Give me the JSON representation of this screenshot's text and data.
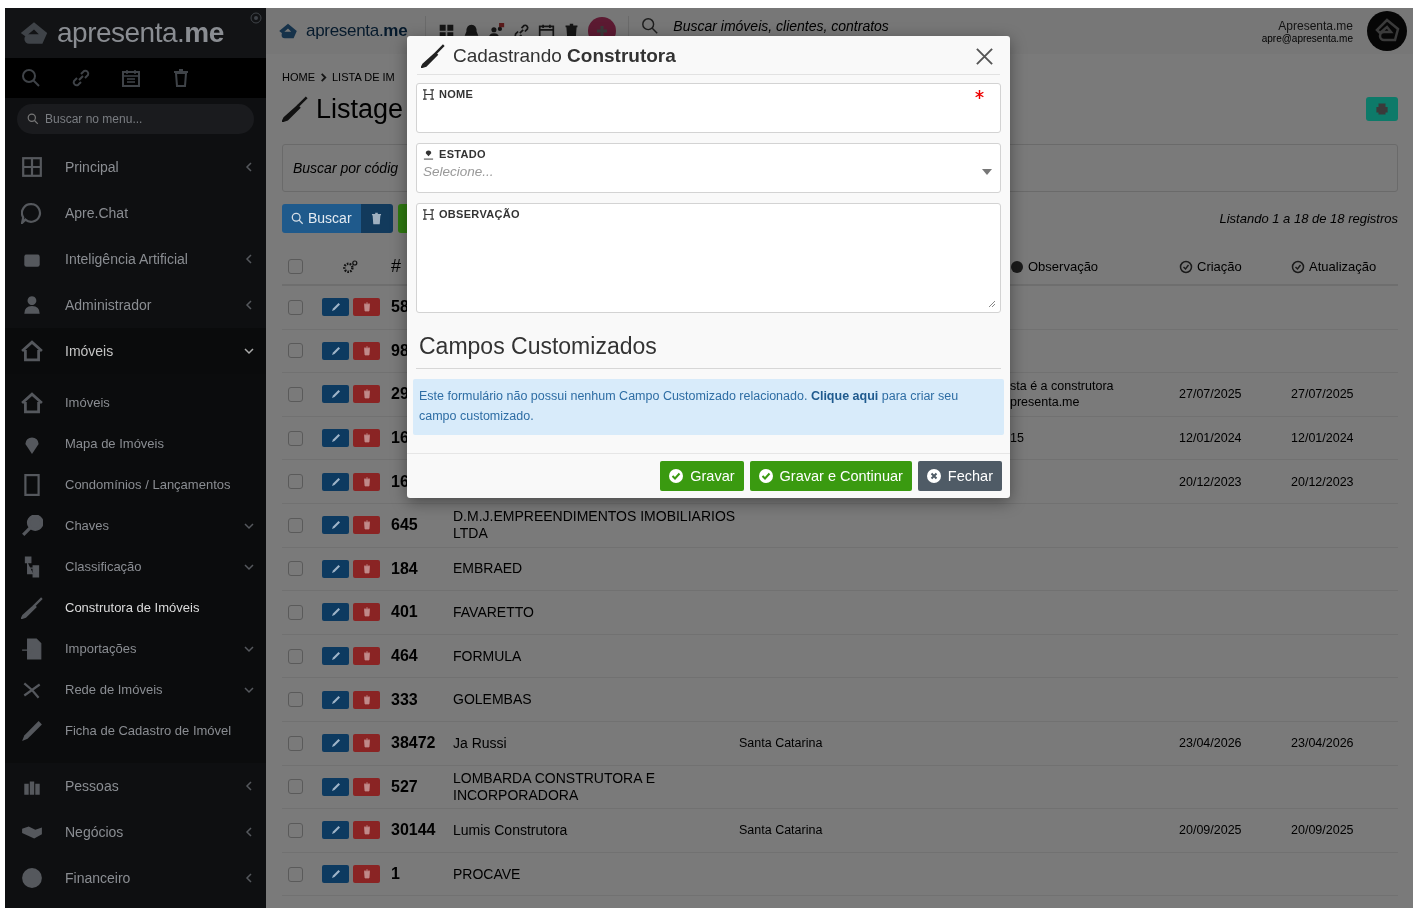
{
  "sidebar": {
    "logo": "apresenta.**me**",
    "search": {
      "placeholder": "Buscar no menu..."
    },
    "items": [
      {
        "label": "Principal",
        "submenu": true,
        "chevron_down": false,
        "selected": false
      },
      {
        "label": "Apre.Chat",
        "submenu": false,
        "selected": false
      },
      {
        "label": "Inteligência Artificial",
        "submenu": true,
        "chevron_down": false,
        "selected": false
      },
      {
        "label": "Administrador",
        "submenu": true,
        "chevron_down": false,
        "selected": false
      },
      {
        "label": "Imóveis",
        "submenu": true,
        "chevron_down": true,
        "expanded": true,
        "selected": false,
        "children": [
          {
            "label": "Imóveis",
            "submenu": false,
            "selected": false
          },
          {
            "label": "Mapa de Imóveis",
            "submenu": false,
            "selected": false
          },
          {
            "label": "Condomínios / Lançamentos",
            "submenu": false,
            "selected": false
          },
          {
            "label": "Chaves",
            "submenu": true,
            "chevron_down": true,
            "selected": false
          },
          {
            "label": "Classificação",
            "submenu": true,
            "chevron_down": true,
            "selected": false
          },
          {
            "label": "Construtora de Imóveis",
            "submenu": false,
            "selected": true
          },
          {
            "label": "Importações",
            "submenu": true,
            "chevron_down": true,
            "selected": false
          },
          {
            "label": "Rede de Imóveis",
            "submenu": true,
            "chevron_down": true,
            "selected": false
          },
          {
            "label": "Ficha de Cadastro de Imóvel",
            "submenu": false,
            "selected": false
          }
        ]
      },
      {
        "label": "Pessoas",
        "submenu": true,
        "chevron_down": false,
        "selected": false
      },
      {
        "label": "Negócios",
        "submenu": true,
        "chevron_down": false,
        "selected": false
      },
      {
        "label": "Financeiro",
        "submenu": true,
        "chevron_down": false,
        "selected": false
      }
    ]
  },
  "topbar": {
    "logo": "apresenta.**me**",
    "search": {
      "placeholder": "Buscar imóveis, clientes, contratos"
    },
    "user": {
      "name": "Apresenta.me",
      "email": "apre@apresenta.me"
    }
  },
  "page": {
    "breadcrumb": [
      "HOME",
      "LISTA DE IM"
    ],
    "title": "Listage",
    "search": {
      "placeholder": "Buscar por códig"
    },
    "search_button": "Buscar",
    "record_count": "Listando 1 a 18 de 18 registros"
  },
  "table": {
    "select_all_checked": false,
    "columns": {
      "id": "#",
      "observacao": "Observação",
      "criacao": "Criação",
      "atualizacao": "Atualização"
    },
    "rows": [
      {
        "id": "58",
        "checked": false
      },
      {
        "id": "98",
        "checked": false
      },
      {
        "id": "29",
        "checked": false,
        "observacao": "sta é a construtora presenta.me",
        "criacao": "27/07/2025",
        "atualizacao": "27/07/2025"
      },
      {
        "id": "16",
        "checked": false,
        "observacao": "15",
        "criacao": "12/01/2024",
        "atualizacao": "12/01/2024"
      },
      {
        "id": "16",
        "checked": false,
        "criacao": "20/12/2023",
        "atualizacao": "20/12/2023"
      },
      {
        "id": "645",
        "checked": false,
        "name": "D.M.J.EMPREENDIMENTOS IMOBILIARIOS LTDA"
      },
      {
        "id": "184",
        "checked": false,
        "name": "EMBRAED"
      },
      {
        "id": "401",
        "checked": false,
        "name": "FAVARETTO"
      },
      {
        "id": "464",
        "checked": false,
        "name": "FORMULA"
      },
      {
        "id": "333",
        "checked": false,
        "name": "GOLEMBAS"
      },
      {
        "id": "38472",
        "checked": false,
        "name": "Ja Russi",
        "estado": "Santa Catarina",
        "criacao": "23/04/2026",
        "atualizacao": "23/04/2026"
      },
      {
        "id": "527",
        "checked": false,
        "name": "LOMBARDA CONSTRUTORA E INCORPORADORA"
      },
      {
        "id": "30144",
        "checked": false,
        "name": "Lumis Construtora",
        "estado": "Santa Catarina",
        "criacao": "20/09/2025",
        "atualizacao": "20/09/2025"
      },
      {
        "id": "1",
        "checked": false,
        "name": "PROCAVE"
      }
    ]
  },
  "modal": {
    "title": "Cadastrando **Construtora**",
    "fields": [
      {
        "kind": "text",
        "label": "NOME",
        "required": true
      },
      {
        "kind": "select",
        "label": "ESTADO",
        "placeholder": "Selecione...",
        "required": false
      },
      {
        "kind": "textarea",
        "label": "OBSERVAÇÃO",
        "required": false
      }
    ],
    "section_title": "Campos Customizados",
    "info": {
      "before": "Este formulário não possui nenhum Campo Customizado relacionado.",
      "link": "Clique aqui",
      "after": "para criar seu campo customizado."
    },
    "buttons": [
      {
        "label": "Gravar",
        "kind": "save"
      },
      {
        "label": "Gravar e Continuar",
        "kind": "save"
      },
      {
        "label": "Fechar",
        "kind": "close"
      }
    ]
  }
}
